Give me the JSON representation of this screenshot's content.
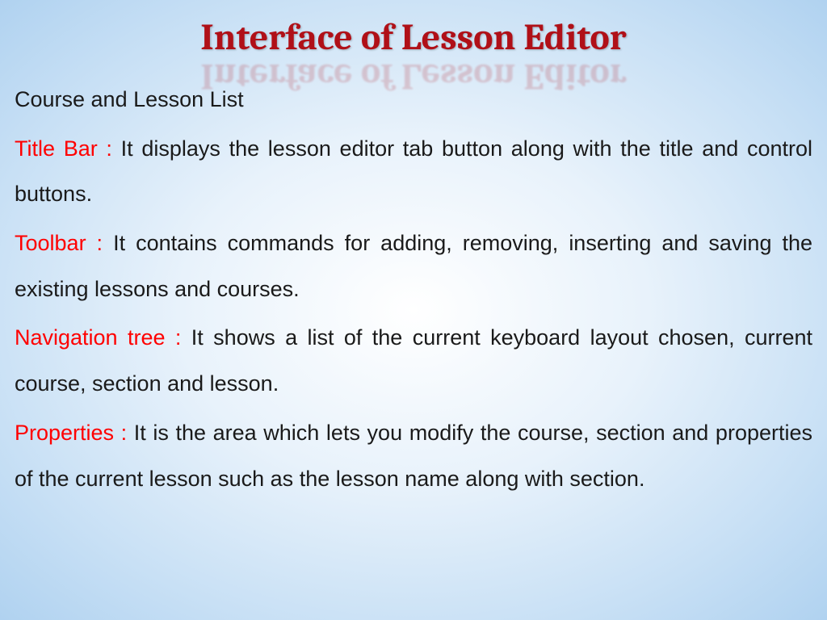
{
  "title": "Interface of Lesson Editor",
  "subtitle": "Course and Lesson List",
  "items": [
    {
      "term": "Title Bar : ",
      "desc": "It displays the lesson editor tab button along with the title and control buttons."
    },
    {
      "term": "Toolbar : ",
      "desc": "It contains commands for adding, removing, inserting and saving the existing lessons and courses."
    },
    {
      "term": "Navigation tree : ",
      "desc": "It shows a list of the current keyboard layout chosen, current course, section and lesson."
    },
    {
      "term": "Properties : ",
      "desc": "It is the area which lets you modify the course, section and properties of the current lesson such as the lesson name along with section."
    }
  ]
}
